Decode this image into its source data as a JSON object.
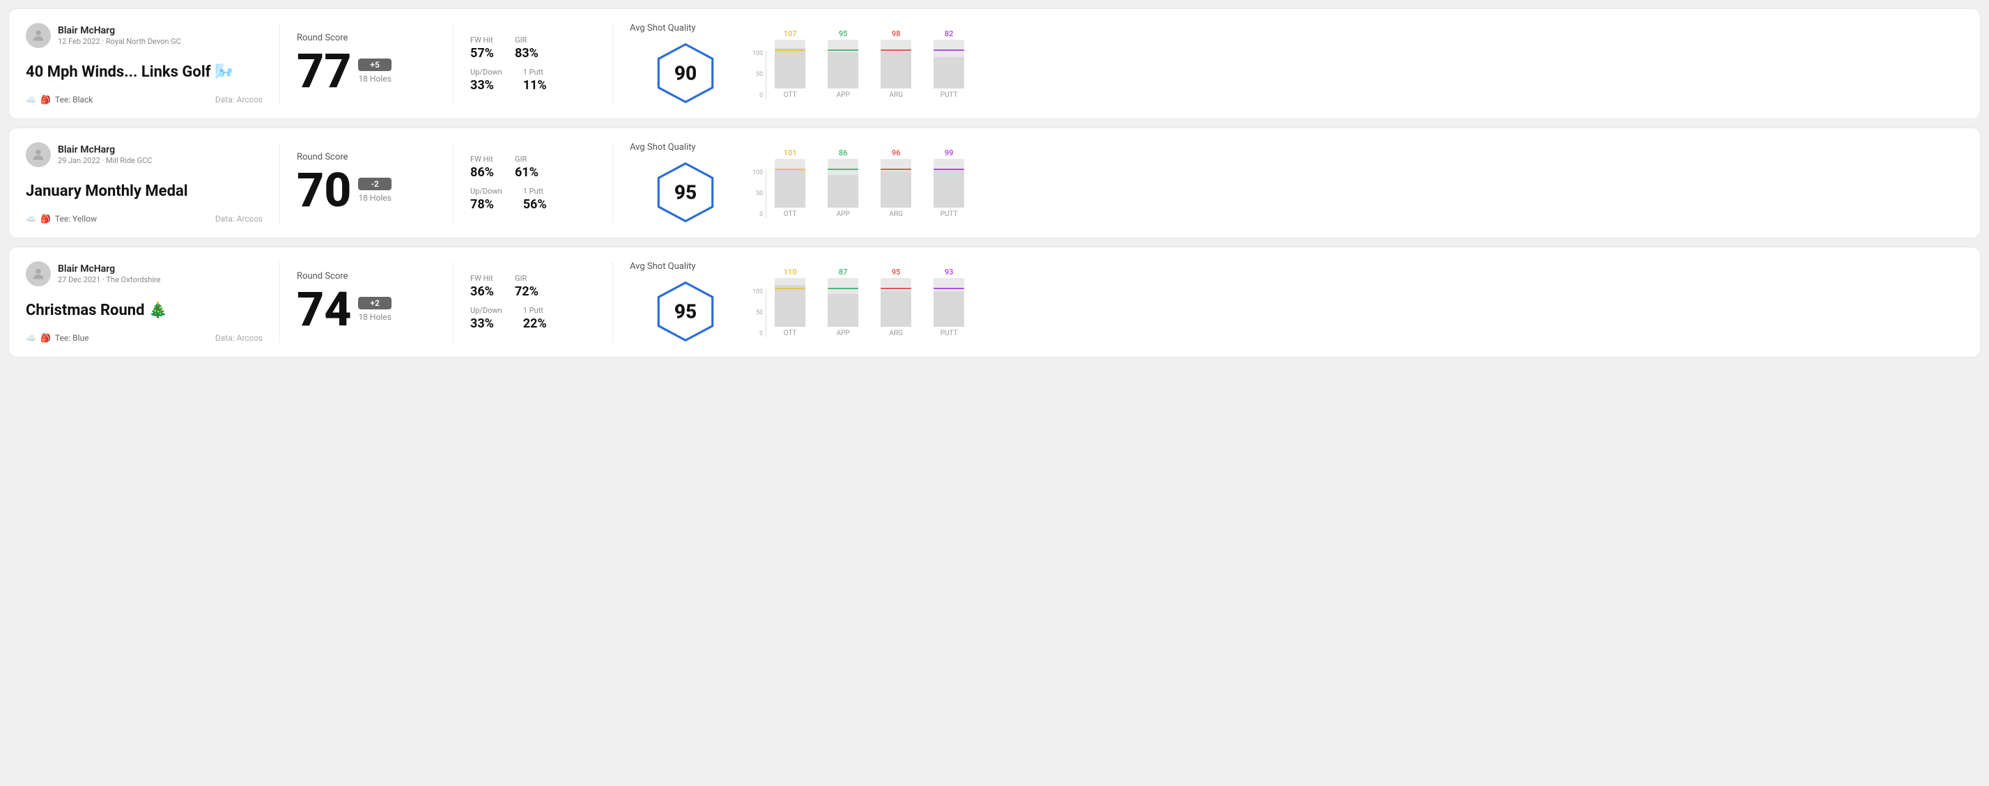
{
  "cards": [
    {
      "id": "card1",
      "user": {
        "name": "Blair McHarg",
        "date": "12 Feb 2022 · Royal North Devon GC"
      },
      "title": "40 Mph Winds... Links Golf 🌬️",
      "tee": "Black",
      "dataSource": "Data: Arccos",
      "score": {
        "label": "Round Score",
        "value": "77",
        "badge": "+5",
        "badgeType": "plus",
        "holes": "18 Holes"
      },
      "stats": {
        "fwHit": {
          "label": "FW Hit",
          "value": "57%"
        },
        "gir": {
          "label": "GIR",
          "value": "83%"
        },
        "upDown": {
          "label": "Up/Down",
          "value": "33%"
        },
        "onePutt": {
          "label": "1 Putt",
          "value": "11%"
        }
      },
      "quality": {
        "label": "Avg Shot Quality",
        "value": "90"
      },
      "chart": {
        "bars": [
          {
            "label": "OTT",
            "value": 107,
            "color": "#e8c44a",
            "maxVal": 130
          },
          {
            "label": "APP",
            "value": 95,
            "color": "#4db87a",
            "maxVal": 130
          },
          {
            "label": "ARG",
            "value": 98,
            "color": "#e05858",
            "maxVal": 130
          },
          {
            "label": "PUTT",
            "value": 82,
            "color": "#b44de0",
            "maxVal": 130
          }
        ]
      }
    },
    {
      "id": "card2",
      "user": {
        "name": "Blair McHarg",
        "date": "29 Jan 2022 · Mill Ride GCC"
      },
      "title": "January Monthly Medal",
      "tee": "Yellow",
      "dataSource": "Data: Arccos",
      "score": {
        "label": "Round Score",
        "value": "70",
        "badge": "-2",
        "badgeType": "minus",
        "holes": "18 Holes"
      },
      "stats": {
        "fwHit": {
          "label": "FW Hit",
          "value": "86%"
        },
        "gir": {
          "label": "GIR",
          "value": "61%"
        },
        "upDown": {
          "label": "Up/Down",
          "value": "78%"
        },
        "onePutt": {
          "label": "1 Putt",
          "value": "56%"
        }
      },
      "quality": {
        "label": "Avg Shot Quality",
        "value": "95"
      },
      "chart": {
        "bars": [
          {
            "label": "OTT",
            "value": 101,
            "color": "#e8c44a",
            "maxVal": 130
          },
          {
            "label": "APP",
            "value": 86,
            "color": "#4db87a",
            "maxVal": 130
          },
          {
            "label": "ARG",
            "value": 96,
            "color": "#e05858",
            "maxVal": 130
          },
          {
            "label": "PUTT",
            "value": 99,
            "color": "#b44de0",
            "maxVal": 130
          }
        ]
      }
    },
    {
      "id": "card3",
      "user": {
        "name": "Blair McHarg",
        "date": "27 Dec 2021 · The Oxfordshire"
      },
      "title": "Christmas Round 🎄",
      "tee": "Blue",
      "dataSource": "Data: Arccos",
      "score": {
        "label": "Round Score",
        "value": "74",
        "badge": "+2",
        "badgeType": "plus",
        "holes": "18 Holes"
      },
      "stats": {
        "fwHit": {
          "label": "FW Hit",
          "value": "36%"
        },
        "gir": {
          "label": "GIR",
          "value": "72%"
        },
        "upDown": {
          "label": "Up/Down",
          "value": "33%"
        },
        "onePutt": {
          "label": "1 Putt",
          "value": "22%"
        }
      },
      "quality": {
        "label": "Avg Shot Quality",
        "value": "95"
      },
      "chart": {
        "bars": [
          {
            "label": "OTT",
            "value": 110,
            "color": "#e8c44a",
            "maxVal": 130
          },
          {
            "label": "APP",
            "value": 87,
            "color": "#4db87a",
            "maxVal": 130
          },
          {
            "label": "ARG",
            "value": 95,
            "color": "#e05858",
            "maxVal": 130
          },
          {
            "label": "PUTT",
            "value": 93,
            "color": "#b44de0",
            "maxVal": 130
          }
        ]
      }
    }
  ],
  "axisLabels": {
    "top": "100",
    "mid": "50",
    "bot": "0"
  }
}
